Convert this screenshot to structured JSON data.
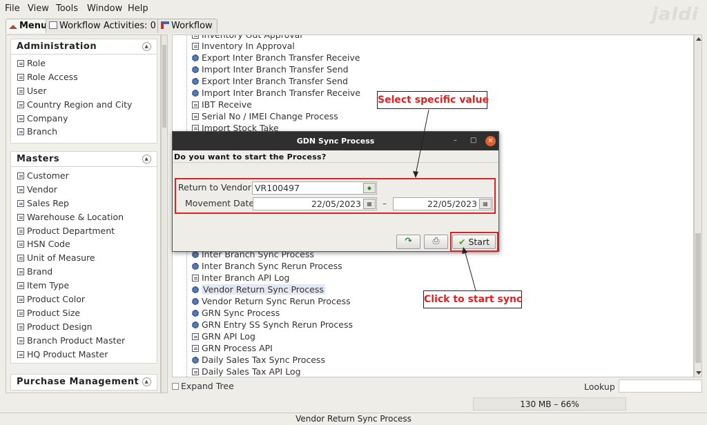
{
  "menubar": {
    "items": [
      "File",
      "View",
      "Tools",
      "Window",
      "Help"
    ]
  },
  "logo": {
    "text": "jaldi"
  },
  "tabs": [
    {
      "label": "Menu"
    },
    {
      "label": "Workflow Activities: 0"
    },
    {
      "label": "Workflow"
    }
  ],
  "sidebar": {
    "administration": {
      "title": "Administration",
      "items": [
        "Role",
        "Role Access",
        "User",
        "Country Region and City",
        "Company",
        "Branch"
      ]
    },
    "masters": {
      "title": "Masters",
      "items": [
        "Customer",
        "Vendor",
        "Sales Rep",
        "Warehouse & Location",
        "Product Department",
        "HSN Code",
        "Unit of Measure",
        "Brand",
        "Item Type",
        "Product Color",
        "Product Size",
        "Product Design",
        "Branch Product Master",
        "HQ Product Master"
      ]
    },
    "purchase": {
      "title": "Purchase Management"
    }
  },
  "tree": {
    "items": [
      {
        "label": "Inventory Out Approval",
        "icon": "form"
      },
      {
        "label": "Inventory In Approval",
        "icon": "form"
      },
      {
        "label": "Export Inter Branch Transfer Receive",
        "icon": "gear"
      },
      {
        "label": "Import Inter Branch Transfer Send",
        "icon": "gear"
      },
      {
        "label": "Export Inter Branch Transfer Send",
        "icon": "gear"
      },
      {
        "label": "Import Inter Branch Transfer Receive",
        "icon": "gear"
      },
      {
        "label": "IBT Receive",
        "icon": "form"
      },
      {
        "label": "Serial No / IMEI Change Process",
        "icon": "form"
      },
      {
        "label": "Import Stock Take",
        "icon": "form"
      },
      {
        "label": "Inter Branch Sync Process",
        "icon": "gear"
      },
      {
        "label": "Inter Branch Sync Rerun Process",
        "icon": "gear"
      },
      {
        "label": "Inter Branch API Log",
        "icon": "form"
      },
      {
        "label": "Vendor Return Sync Process",
        "icon": "gear",
        "selected": true
      },
      {
        "label": "Vendor Return Sync Rerun Process",
        "icon": "gear"
      },
      {
        "label": "GRN Sync Process",
        "icon": "gear"
      },
      {
        "label": "GRN Entry SS Synch Rerun Process",
        "icon": "gear"
      },
      {
        "label": "GRN API Log",
        "icon": "form"
      },
      {
        "label": "GRN Process API",
        "icon": "form"
      },
      {
        "label": "Daily Sales Tax Sync Process",
        "icon": "gear"
      },
      {
        "label": "Daily Sales Tax API Log",
        "icon": "form"
      }
    ]
  },
  "bottom": {
    "expand_tree": "Expand Tree",
    "lookup": "Lookup",
    "memory": "130 MB – 66%",
    "status": "Vendor Return Sync Process"
  },
  "dialog": {
    "title": "GDN Sync Process",
    "controls": [
      "–",
      "□",
      "✕"
    ],
    "question": "Do you want to start the Process?",
    "return_to_vendor_label": "Return to Vendor",
    "return_to_vendor_value": "VR100497",
    "movement_date_label": "Movement Date",
    "date_from": "22/05/2023",
    "date_to": "22/05/2023",
    "date_separator": "–",
    "start_label": "Start"
  },
  "callouts": {
    "select": "Select specific value",
    "start": "Click to start sync"
  },
  "colors": {
    "annotation_red": "#e02020",
    "titlebar": "#2f2f2f"
  }
}
